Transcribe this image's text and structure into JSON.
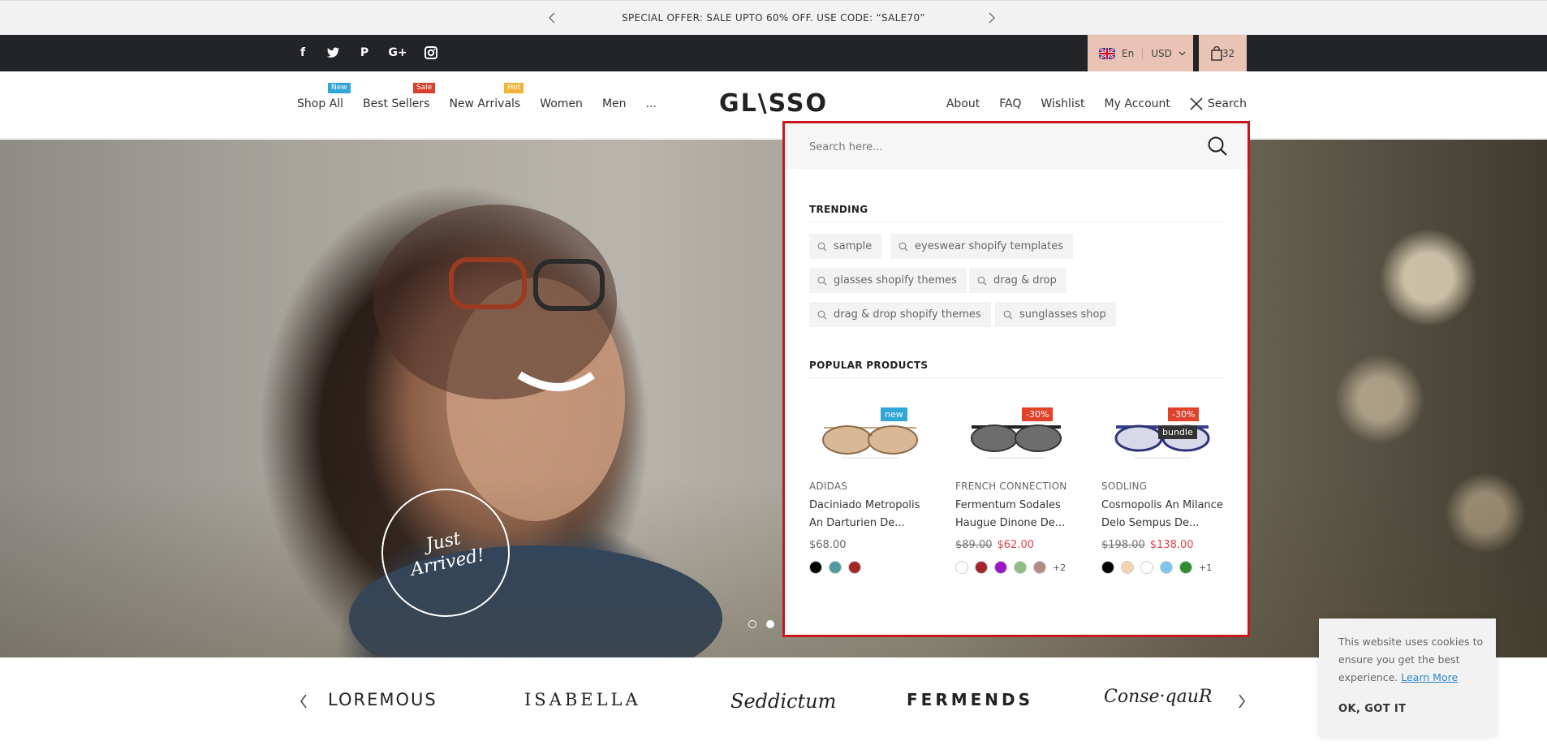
{
  "announcement": {
    "text": "SPECIAL OFFER: SALE UPTO 60% OFF. USE CODE: “SALE70”"
  },
  "topbar": {
    "language": "En",
    "currency": "USD",
    "cart_count": "32"
  },
  "nav_left": [
    {
      "label": "Shop All",
      "tag": "New",
      "tag_color": "#31a6d9"
    },
    {
      "label": "Best Sellers",
      "tag": "Sale",
      "tag_color": "#d9412e"
    },
    {
      "label": "New Arrivals",
      "tag": "Hot",
      "tag_color": "#f0b43b"
    },
    {
      "label": "Women",
      "tag": "",
      "tag_color": ""
    },
    {
      "label": "Men",
      "tag": "",
      "tag_color": ""
    },
    {
      "label": "...",
      "tag": "",
      "tag_color": ""
    }
  ],
  "logo": "GL\\SSO",
  "nav_right": {
    "about": "About",
    "faq": "FAQ",
    "wishlist": "Wishlist",
    "account": "My Account",
    "search": "Search"
  },
  "hero": {
    "badge_line1": "Just",
    "badge_line2": "Arrived!"
  },
  "search_panel": {
    "placeholder": "Search here...",
    "trending_title": "TRENDING",
    "trending": [
      "sample",
      "eyeswear shopify templates",
      "glasses shopify themes",
      "drag & drop",
      "drag & drop shopify themes",
      "sunglasses shop"
    ],
    "popular_title": "POPULAR PRODUCTS",
    "products": [
      {
        "labels": [
          "new"
        ],
        "vendor": "ADIDAS",
        "name": "Daciniado Metropolis An Darturien De...",
        "old_price": "",
        "price": "$68.00",
        "swatches": [
          "#000000",
          "#4f9a9e",
          "#a3262b"
        ],
        "more": ""
      },
      {
        "labels": [
          "-30%"
        ],
        "vendor": "FRENCH CONNECTION",
        "name": "Fermentum Sodales Haugue Dinone De...",
        "old_price": "$89.00",
        "price": "$62.00",
        "swatches": [
          "#ffffff",
          "#a3262b",
          "#9b16c8",
          "#8fbf85",
          "#b58a86"
        ],
        "more": "+2"
      },
      {
        "labels": [
          "-30%",
          "bundle"
        ],
        "vendor": "SODLING",
        "name": "Cosmopolis An Milance Delo Sempus De...",
        "old_price": "$198.00",
        "price": "$138.00",
        "swatches": [
          "#000000",
          "#f5d5b0",
          "#ffffff",
          "#7cc6f0",
          "#2f8c2f"
        ],
        "more": "+1"
      }
    ]
  },
  "brands": [
    "LOREMOUS",
    "ISABELLA",
    "Seddictum",
    "FERMENDS",
    "Conse·qauR"
  ],
  "cookie": {
    "text": "This website uses cookies to ensure you get the best experience.",
    "learn_more": "Learn More",
    "ok": "OK, GOT IT"
  },
  "colors": {
    "accent_peach": "#e9c3b4",
    "topbar": "#222428",
    "highlight_border": "#c8171e",
    "sale_red": "#e0434a"
  }
}
